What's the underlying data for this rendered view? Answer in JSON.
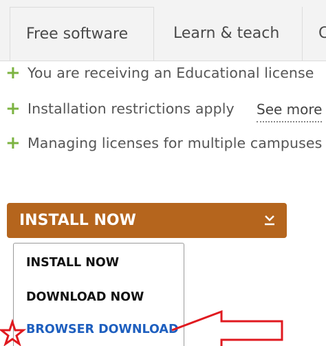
{
  "tabs": [
    {
      "label": "Free software"
    },
    {
      "label": "Learn & teach"
    },
    {
      "label": "C"
    }
  ],
  "features": [
    {
      "text": "You are receiving an Educational license"
    },
    {
      "text": "Installation restrictions apply"
    },
    {
      "text": "Managing licenses for multiple campuses"
    }
  ],
  "see_more": "See more",
  "install_button": {
    "label": "INSTALL NOW",
    "icon": "download-icon"
  },
  "dropdown": {
    "items": [
      {
        "label": "INSTALL NOW"
      },
      {
        "label": "DOWNLOAD NOW"
      },
      {
        "label": "BROWSER DOWNLOAD"
      }
    ]
  },
  "colors": {
    "install_button_bg": "#b5651d",
    "plus_green": "#7cb342",
    "link_blue": "#1e5fbf",
    "annotation_red": "#e0191f"
  }
}
